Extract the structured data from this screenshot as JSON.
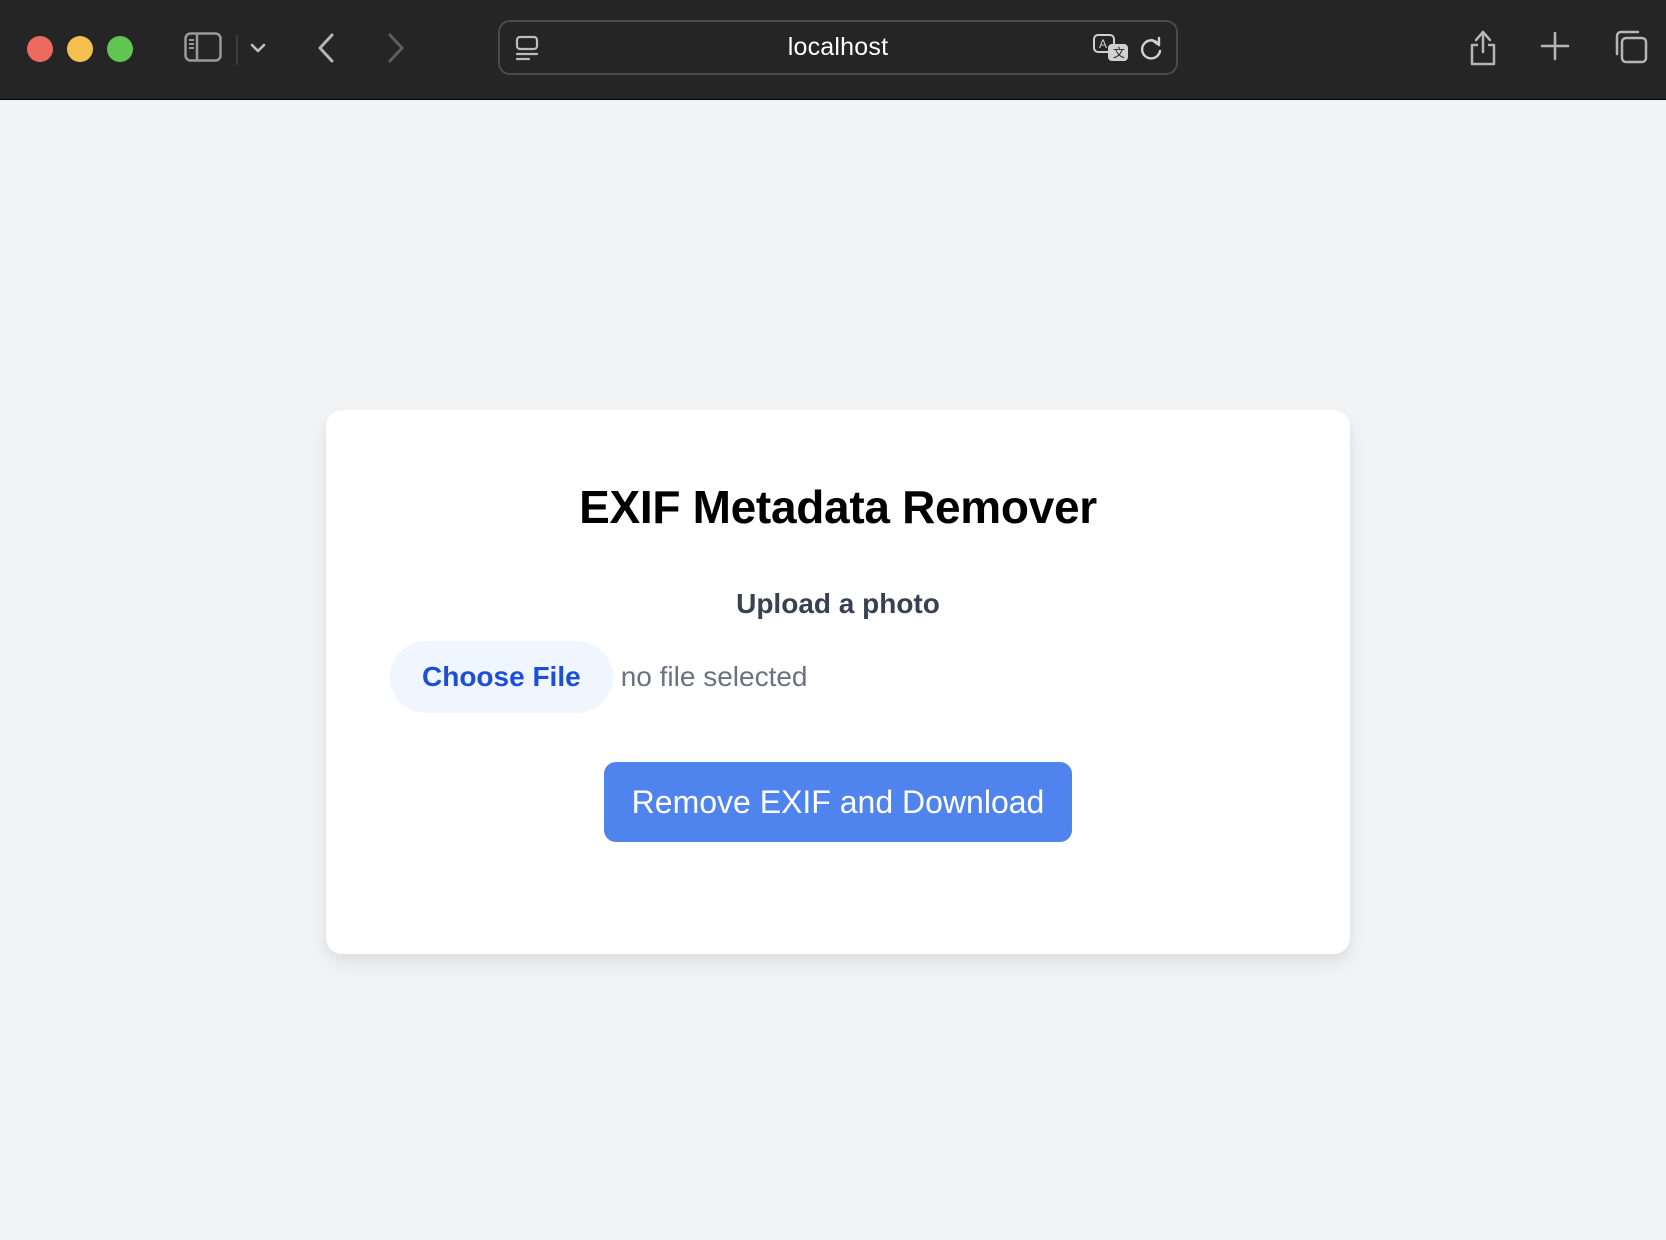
{
  "browser": {
    "address": "localhost",
    "icons": {
      "sidebar": "sidebar-icon",
      "tab_group_menu": "chevron-down-icon",
      "back": "back-arrow-icon",
      "forward": "forward-arrow-icon",
      "page_menu": "page-menu-icon",
      "translate": "translate-icon",
      "reload": "reload-icon",
      "share": "share-icon",
      "new_tab": "plus-icon",
      "tab_overview": "tabs-overview-icon"
    }
  },
  "page": {
    "title": "EXIF Metadata Remover",
    "upload_label": "Upload a photo",
    "choose_file_label": "Choose File",
    "file_status": "no file selected",
    "submit_label": "Remove EXIF and Download"
  },
  "colors": {
    "page_background": "#f3f4f6",
    "card_background": "#ffffff",
    "primary_button": "#4f83ee",
    "file_button_background": "#eff6ff",
    "file_button_text": "#1d4ed8",
    "chrome_background": "#252525"
  }
}
